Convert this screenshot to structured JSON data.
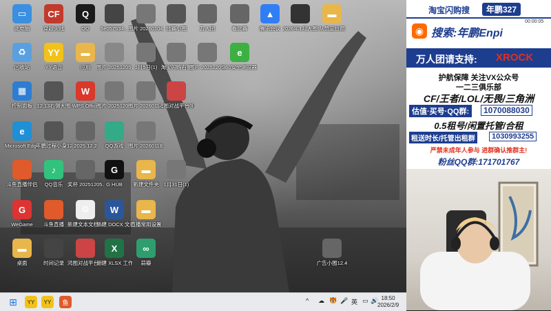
{
  "desktop": {
    "icons": [
      {
        "label": "此电脑",
        "glyph": "▭",
        "color": "#3b8fe0"
      },
      {
        "label": "穿越火线",
        "glyph": "CF",
        "color": "#c23a2b"
      },
      {
        "label": "QQ",
        "glyph": "Q",
        "color": "#1a1a1a"
      },
      {
        "label": "5e057534...",
        "glyph": "",
        "color": "#444"
      },
      {
        "label": "图片 20260104...",
        "glyph": "",
        "color": "#777"
      },
      {
        "label": "比赛小图",
        "glyph": "",
        "color": "#555"
      },
      {
        "label": "万人团",
        "glyph": "",
        "color": "#666"
      },
      {
        "label": "看比赛",
        "glyph": "",
        "color": "#666"
      },
      {
        "label": "腾讯会议",
        "glyph": "▲",
        "color": "#2f7ef6"
      },
      {
        "label": "2026年1月大图57都要令",
        "glyph": "",
        "color": "#333"
      },
      {
        "label": "队员定位照",
        "glyph": "▬",
        "color": "#e8b64a"
      },
      {
        "label": "回收站",
        "glyph": "♻",
        "color": "#5aa0e0"
      },
      {
        "label": "YY语音",
        "glyph": "YY",
        "color": "#f2c21b"
      },
      {
        "label": "应用",
        "glyph": "▬",
        "color": "#e8b64a"
      },
      {
        "label": "图片 20251205...",
        "glyph": "",
        "color": "#888"
      },
      {
        "label": "1月5日(1)",
        "glyph": "",
        "color": "#777"
      },
      {
        "label": "淘宝闪购右侧",
        "glyph": "",
        "color": "#777"
      },
      {
        "label": "图片 20251205...",
        "glyph": "",
        "color": "#777"
      },
      {
        "label": "360安全浏览器",
        "glyph": "e",
        "color": "#3cb043"
      },
      {
        "label": "控制面板",
        "glyph": "▦",
        "color": "#2d7dd2"
      },
      {
        "label": "12.13右侧大图",
        "glyph": "",
        "color": "#555"
      },
      {
        "label": "WPS Office",
        "glyph": "W",
        "color": "#d9382a"
      },
      {
        "label": "图片 20251205...",
        "glyph": "",
        "color": "#777"
      },
      {
        "label": "图片 20260118...",
        "glyph": "",
        "color": "#777"
      },
      {
        "label": "鸿图对战平台(红警战网)2...",
        "glyph": "",
        "color": "#c44"
      },
      {
        "label": "Microsoft Edge",
        "glyph": "e",
        "color": "#1f8fd6"
      },
      {
        "label": "年鹏过程小身12.3",
        "glyph": "",
        "color": "#555"
      },
      {
        "label": "2025.12.2",
        "glyph": "",
        "color": "#666"
      },
      {
        "label": "QQ游戏",
        "glyph": "",
        "color": "#3a8"
      },
      {
        "label": "图片 20260118...",
        "glyph": "",
        "color": "#777"
      },
      {
        "label": "斗鱼直播伴侣",
        "glyph": "",
        "color": "#e05a2b"
      },
      {
        "label": "QQ音乐",
        "glyph": "♪",
        "color": "#31c27c"
      },
      {
        "label": "奖杯 20251205...",
        "glyph": "",
        "color": "#666"
      },
      {
        "label": "G HUB",
        "glyph": "G",
        "color": "#111"
      },
      {
        "label": "新建文件夹",
        "glyph": "▬",
        "color": "#e8b64a"
      },
      {
        "label": "1月31日(1)",
        "glyph": "",
        "color": "#777"
      },
      {
        "label": "WeGame",
        "glyph": "G",
        "color": "#d33"
      },
      {
        "label": "斗鱼直播",
        "glyph": "",
        "color": "#e05a2b"
      },
      {
        "label": "新建文本文档 WIN10 ...",
        "glyph": "⚙",
        "color": "#eee"
      },
      {
        "label": "新建 DOCX 文档",
        "glyph": "W",
        "color": "#2b579a"
      },
      {
        "label": "直播常用设置",
        "glyph": "▬",
        "color": "#e8b64a"
      },
      {
        "label": "桌面",
        "glyph": "▬",
        "color": "#e8b64a"
      },
      {
        "label": "时间记录",
        "glyph": "",
        "color": "#444"
      },
      {
        "label": "鸿图对战平台(红警战网)",
        "glyph": "",
        "color": "#c44"
      },
      {
        "label": "新建 XLSX 工作表",
        "glyph": "X",
        "color": "#217346"
      },
      {
        "label": "蒜瓣",
        "glyph": "∞",
        "color": "#2e9e6e"
      },
      {
        "label": "广告小图12.4",
        "glyph": "",
        "color": "#666"
      }
    ]
  },
  "taskbar": {
    "tray": {
      "icons": [
        "^",
        "☁",
        "🐯",
        "🎤",
        "英",
        "▭",
        "🔊"
      ],
      "time": "18:50",
      "date": "2026/2/9"
    }
  },
  "panel": {
    "top_left": "淘宝闪购搜",
    "top_right": "年鹏327",
    "corner": "00:00:05",
    "search_label": "搜索:年鹏Enpi",
    "support_prefix": "万人团请支持:",
    "support_name": "XROCK",
    "line1": "护航保障 关注VX公众号",
    "line2": "一二三俱乐部",
    "games": "CF/王者/LOL/无畏/三角洲",
    "appraise_label": "估值·买号·QQ群:",
    "appraise_num": "1070088030",
    "rent": "0.5租号/闲置托管/合租",
    "rent_label": "租送时长/托管出租群",
    "rent_num": "1030993255",
    "warning": "严禁未成年人参与 进群确认推群主!",
    "fans": "粉丝QQ群:171701767"
  },
  "colors": {
    "panel_blue": "#1d3d8f",
    "panel_red": "#e0301e",
    "accent_cyan": "#16b3d6"
  }
}
